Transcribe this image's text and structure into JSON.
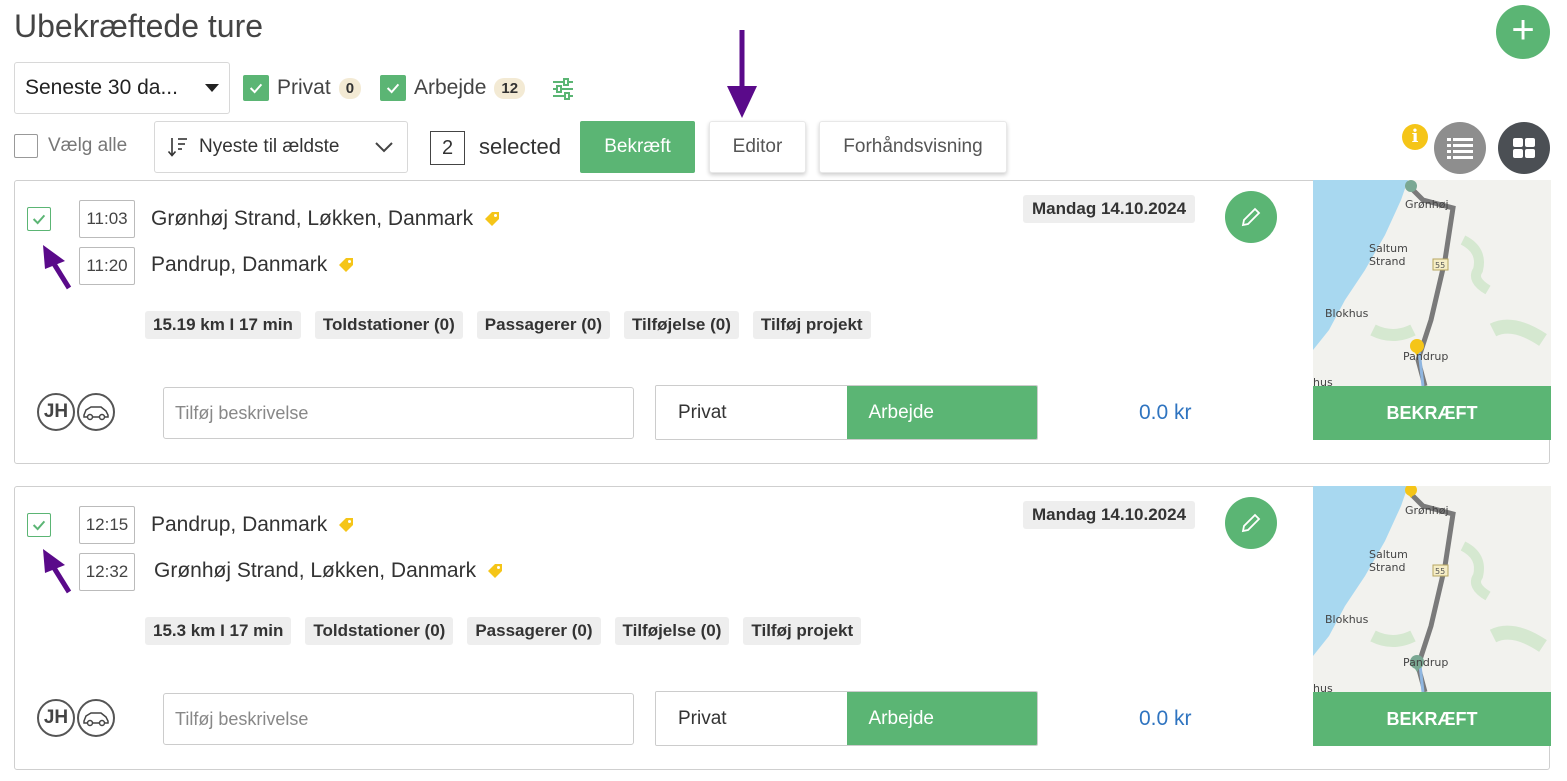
{
  "header": {
    "title": "Ubekræftede ture",
    "add_symbol": "+"
  },
  "filters": {
    "period": "Seneste 30 da...",
    "private_label": "Privat",
    "private_count": "0",
    "work_label": "Arbejde",
    "work_count": "12"
  },
  "toolbar": {
    "select_all": "Vælg alle",
    "sort": "Nyeste til ældste",
    "selected_count": "2",
    "selected_label": "selected",
    "confirm": "Bekræft",
    "editor": "Editor",
    "preview": "Forhåndsvisning",
    "info_symbol": "i"
  },
  "colors": {
    "accent": "#5bb574",
    "amount": "#2f74c0",
    "annotation": "#5a0a8a"
  },
  "trips": [
    {
      "start_time": "11:03",
      "end_time": "11:20",
      "from": "Grønhøj Strand, Løkken, Danmark",
      "to": "Pandrup, Danmark",
      "chips": [
        "15.19 km I 17 min",
        "Toldstationer (0)",
        "Passagerer (0)",
        "Tilføjelse (0)",
        "Tilføj projekt"
      ],
      "date": "Mandag 14.10.2024",
      "avatar": "JH",
      "description_placeholder": "Tilføj beskrivelse",
      "type_private": "Privat",
      "type_work": "Arbejde",
      "amount": "0.0 kr",
      "confirm": "BEKRÆFT",
      "map_labels": {
        "a": "Grønhøj",
        "b": "Saltum",
        "c": "Strand",
        "d": "Blokhus",
        "e": "Pandrup",
        "f": "hus",
        "road": "55"
      }
    },
    {
      "start_time": "12:15",
      "end_time": "12:32",
      "from": "Pandrup, Danmark",
      "to": "Grønhøj Strand, Løkken, Danmark",
      "chips": [
        "15.3 km I 17 min",
        "Toldstationer (0)",
        "Passagerer (0)",
        "Tilføjelse (0)",
        "Tilføj projekt"
      ],
      "date": "Mandag 14.10.2024",
      "avatar": "JH",
      "description_placeholder": "Tilføj beskrivelse",
      "type_private": "Privat",
      "type_work": "Arbejde",
      "amount": "0.0 kr",
      "confirm": "BEKRÆFT",
      "map_labels": {
        "a": "Grønhøj",
        "b": "Saltum",
        "c": "Strand",
        "d": "Blokhus",
        "e": "Pandrup",
        "f": "hus",
        "road": "55"
      }
    }
  ]
}
